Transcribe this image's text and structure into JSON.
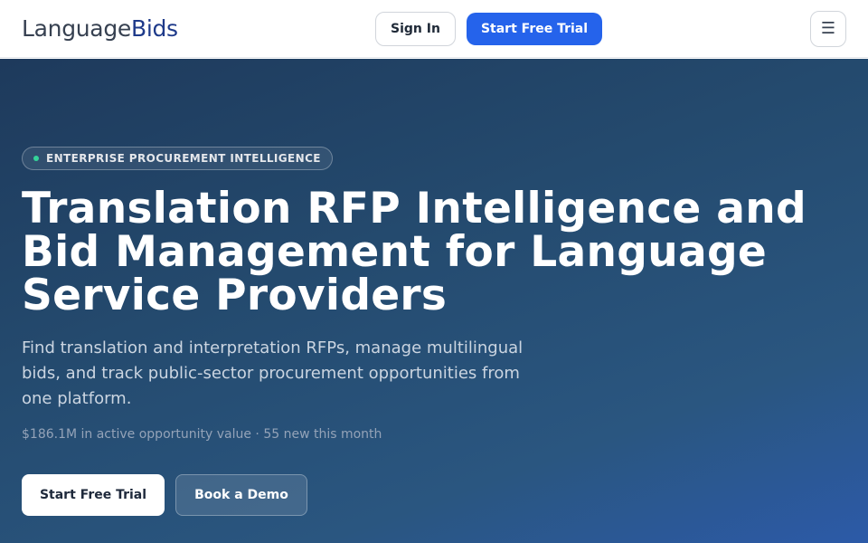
{
  "header": {
    "logo_part1": "Language",
    "logo_part2": "Bids",
    "sign_in_label": "Sign In",
    "trial_label": "Start Free Trial",
    "menu_icon": "hamburger-icon",
    "menu_glyph": "☰"
  },
  "hero": {
    "badge": "ENTERPRISE PROCUREMENT INTELLIGENCE",
    "title_line1": "Translation RFP Intelligence and",
    "title_line2": "Bid Management for Language",
    "title_line3": "Service Providers",
    "subtitle": "Find translation and interpretation RFPs, manage multilingual bids, and track public-sector procurement opportunities from one platform.",
    "stats": "$186.1M in active opportunity value · 55 new this month",
    "primary_cta": "Start Free Trial",
    "secondary_cta": "Book a Demo"
  },
  "colors": {
    "brand_blue": "#2563eb",
    "logo_accent": "#1e3a8a",
    "badge_dot": "#34d399",
    "hero_gradient_start": "#1e3a5c",
    "hero_gradient_end": "#2c5aa8"
  }
}
